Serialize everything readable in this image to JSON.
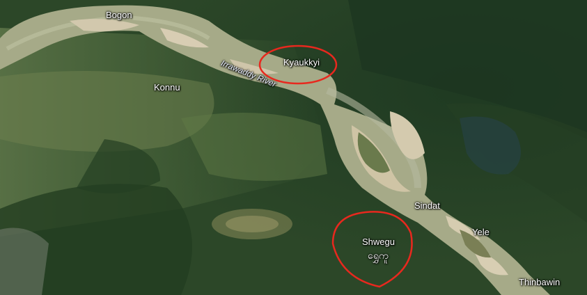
{
  "map": {
    "river_name": "Irrawaddy River",
    "places": {
      "bogon": "Bogon",
      "konnu": "Konnu",
      "kyaukkyi": "Kyaukkyi",
      "sindat": "Sindat",
      "yele": "Yele",
      "shwegu": "Shwegu",
      "shwegu_local": "ရွှေကူ",
      "thinbawin": "Thinbawin"
    },
    "colors": {
      "forest": "#2f4a2a",
      "river": "#a7ab8a",
      "sandbar": "#d6ccb1",
      "highlight_circle": "#e8281e"
    }
  }
}
